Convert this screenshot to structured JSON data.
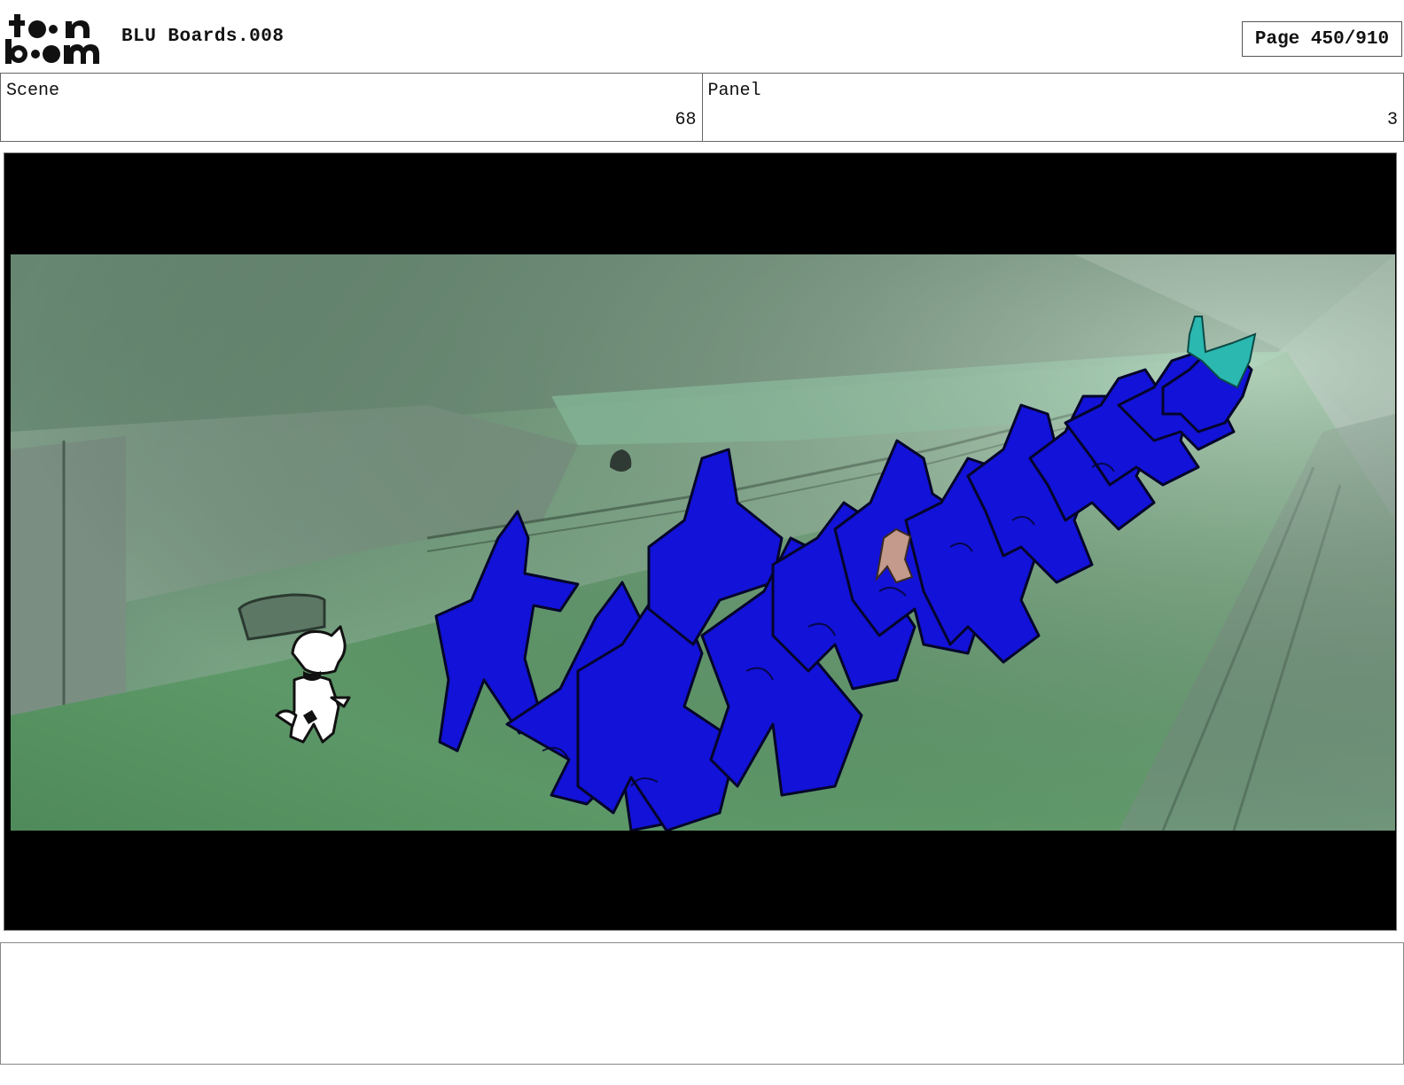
{
  "header": {
    "logo_text": "toon boom",
    "title": "BLU Boards.008",
    "page_label": "Page 450/910"
  },
  "info": {
    "scene_label": "Scene",
    "scene_value": "68",
    "panel_label": "Panel",
    "panel_value": "3"
  },
  "panel_image": {
    "description_icon": "storyboard-frame",
    "colors": {
      "letterbox": "#000000",
      "background_green": "#6fae80",
      "crowd_blue": "#1010d8",
      "lead_figure_teal": "#2ab8b0"
    }
  },
  "caption": {
    "text": ""
  }
}
